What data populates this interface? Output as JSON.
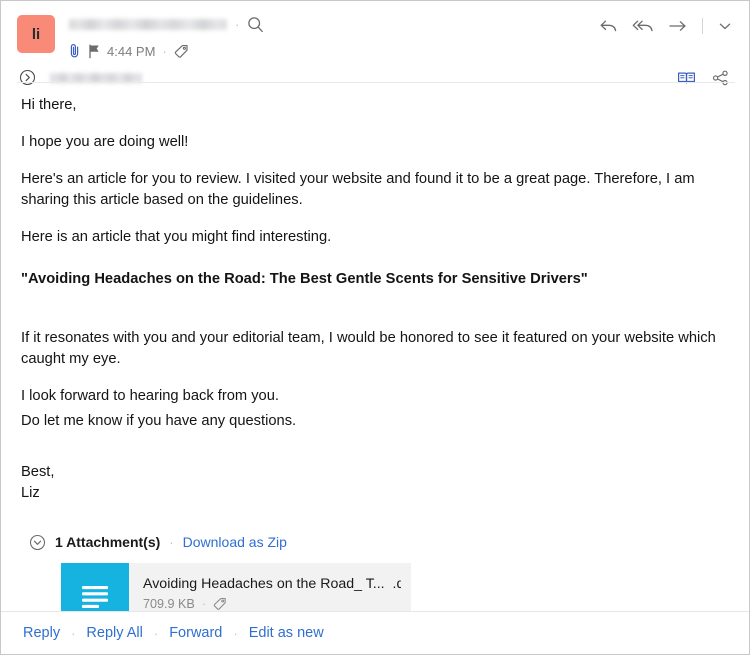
{
  "header": {
    "avatar_initials": "li",
    "sender_redacted": true,
    "timestamp": "4:44 PM",
    "separator": "·",
    "icons": {
      "search": "search-icon",
      "attachment": "paperclip-icon",
      "flag": "flag-icon",
      "tag": "tag-icon",
      "expand": "chevron-right-circle-icon",
      "reply": "reply-arrow-icon",
      "reply_all": "reply-all-arrow-icon",
      "forward": "forward-arrow-icon",
      "more": "chevron-down-icon",
      "reading_mode": "open-book-icon",
      "share": "share-icon"
    }
  },
  "body": {
    "greeting": "Hi there,",
    "paragraph_1": "I hope you are doing well!",
    "paragraph_2": "Here's an article for you to review. I visited your website and found it to be a great page. Therefore, I am sharing this article based on the guidelines.",
    "paragraph_3": "Here is an article that you might find interesting.",
    "headline": "\"Avoiding Headaches on the Road: The Best Gentle Scents for Sensitive Drivers\"",
    "paragraph_4": "If it resonates with you and your editorial team, I would be honored to see it featured on your website which caught my eye.",
    "paragraph_5a": "I look forward to hearing back from you.",
    "paragraph_5b": "Do let me know if you have any questions.",
    "signoff": "Best,",
    "signature_name": "Liz"
  },
  "attachments": {
    "count_label": "1 Attachment(s)",
    "separator": "·",
    "download_zip_label": "Download as Zip",
    "items": [
      {
        "name": "Avoiding Headaches on the Road_ T...",
        "extension": ".docx",
        "size": "709.9 KB",
        "separator": "·",
        "icon_color": "#16b2e0"
      }
    ]
  },
  "footer": {
    "actions": [
      "Reply",
      "Reply All",
      "Forward",
      "Edit as new"
    ],
    "separator": "·"
  },
  "colors": {
    "avatar_bg": "#fa8a78",
    "link": "#2f6fd0",
    "icon_blue": "#3b5fc0",
    "icon_gray": "#7d7d82",
    "file_icon": "#16b2e0",
    "card_bg": "#f2f2f2"
  }
}
